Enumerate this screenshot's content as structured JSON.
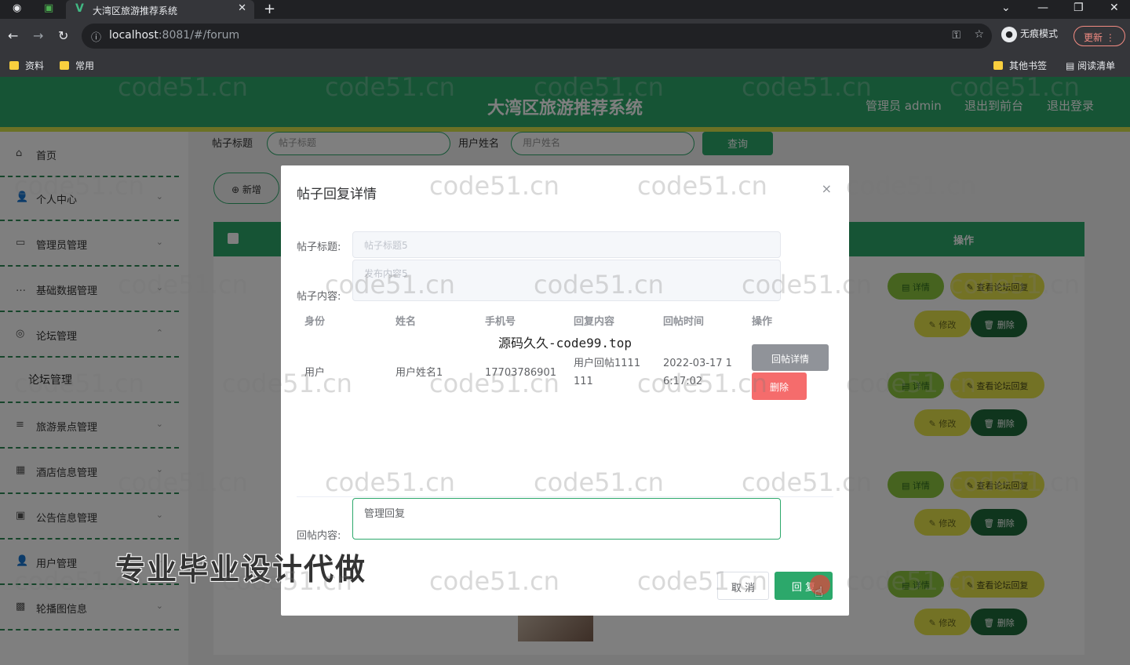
{
  "browser": {
    "tab_title": "大湾区旅游推荐系统",
    "url_host": "localhost",
    "url_rest": ":8081/#/forum",
    "incognito_label": "无痕模式",
    "update_label": "更新",
    "bookmarks": [
      "资料",
      "常用"
    ],
    "bookmarks_right": [
      "其他书签",
      "阅读清单"
    ]
  },
  "header": {
    "title": "大湾区旅游推荐系统",
    "user": "管理员 admin",
    "back_front": "退出到前台",
    "logout": "退出登录"
  },
  "sidebar": {
    "items": [
      {
        "label": "首页",
        "icon": "home-icon"
      },
      {
        "label": "个人中心",
        "icon": "user-icon"
      },
      {
        "label": "管理员管理",
        "icon": "admin-icon"
      },
      {
        "label": "基础数据管理",
        "icon": "data-icon"
      },
      {
        "label": "论坛管理",
        "icon": "forum-icon"
      },
      {
        "label": "旅游景点管理",
        "icon": "list-icon"
      },
      {
        "label": "酒店信息管理",
        "icon": "grid-icon"
      },
      {
        "label": "公告信息管理",
        "icon": "notice-icon"
      },
      {
        "label": "用户管理",
        "icon": "user-icon"
      },
      {
        "label": "轮播图信息",
        "icon": "image-icon"
      }
    ],
    "active_sub": "论坛管理"
  },
  "search": {
    "label1": "帖子标题",
    "placeholder1": "帖子标题",
    "label2": "用户姓名",
    "placeholder2": "用户姓名",
    "button": "查询"
  },
  "toolbar": {
    "add": "新增"
  },
  "table": {
    "op_header": "操作",
    "actions": {
      "detail": "详情",
      "forum": "查看论坛回复",
      "edit": "修改",
      "delete": "删除"
    }
  },
  "dialog": {
    "title": "帖子回复详情",
    "close": "×",
    "title_label": "帖子标题:",
    "title_value": "帖子标题5",
    "content_label": "帖子内容:",
    "content_value": "发布内容5",
    "columns": [
      "身份",
      "姓名",
      "手机号",
      "回复内容",
      "回帖时间",
      "操作"
    ],
    "row": {
      "identity": "用户",
      "name": "用户姓名1",
      "phone": "17703786901",
      "reply_line1": "用户回帖1111",
      "reply_line2": "111",
      "time_line1": "2022-03-17 1",
      "time_line2": "6:17:02",
      "detail_btn": "回帖详情",
      "delete_btn": "删除"
    },
    "reply_label": "回帖内容:",
    "reply_value": "管理回复",
    "cancel": "取 消",
    "submit": "回 复"
  },
  "overlays": {
    "source": "源码久久-code99.top",
    "promo": "专业毕业设计代做",
    "watermark": "code51.cn"
  }
}
